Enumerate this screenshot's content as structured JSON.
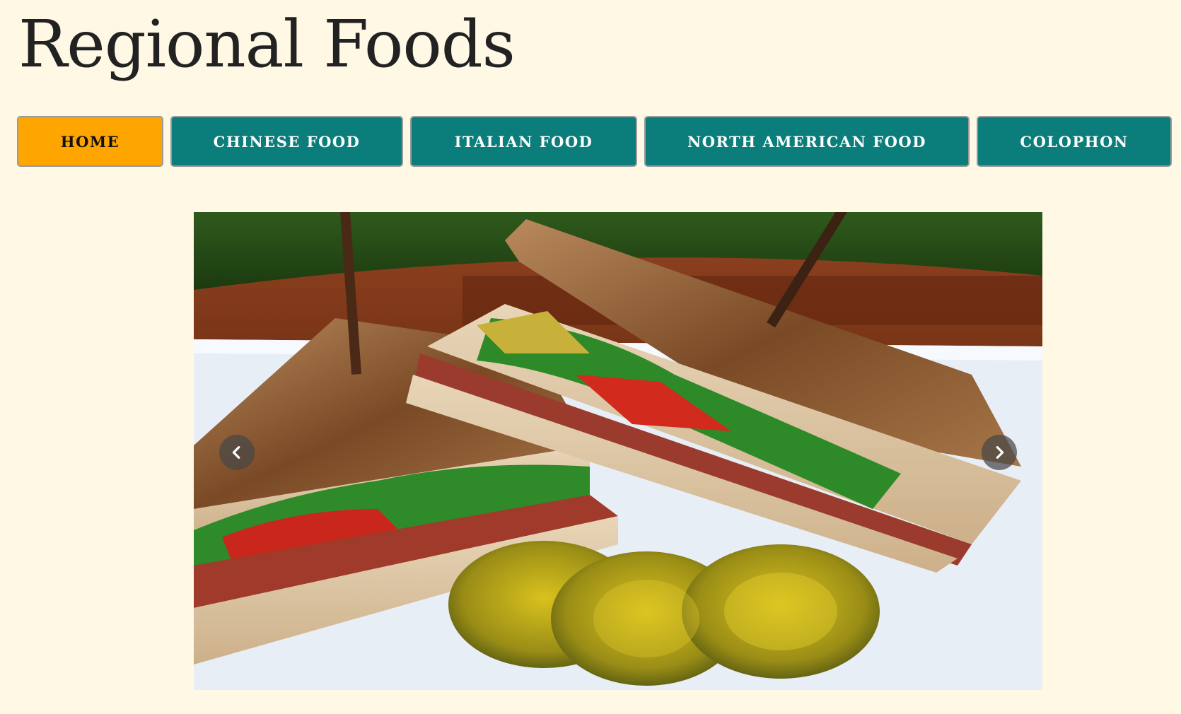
{
  "site": {
    "title": "Regional Foods"
  },
  "nav": {
    "items": [
      {
        "label": "HOME",
        "active": true
      },
      {
        "label": "CHINESE FOOD",
        "active": false
      },
      {
        "label": "ITALIAN FOOD",
        "active": false
      },
      {
        "label": "NORTH AMERICAN FOOD",
        "active": false
      },
      {
        "label": "COLOPHON",
        "active": false
      }
    ]
  },
  "carousel": {
    "prev_icon": "chevron-left-icon",
    "next_icon": "chevron-right-icon"
  },
  "colors": {
    "background": "#fff8e5",
    "nav_default": "#0b7e7b",
    "nav_active": "#ffa500"
  }
}
